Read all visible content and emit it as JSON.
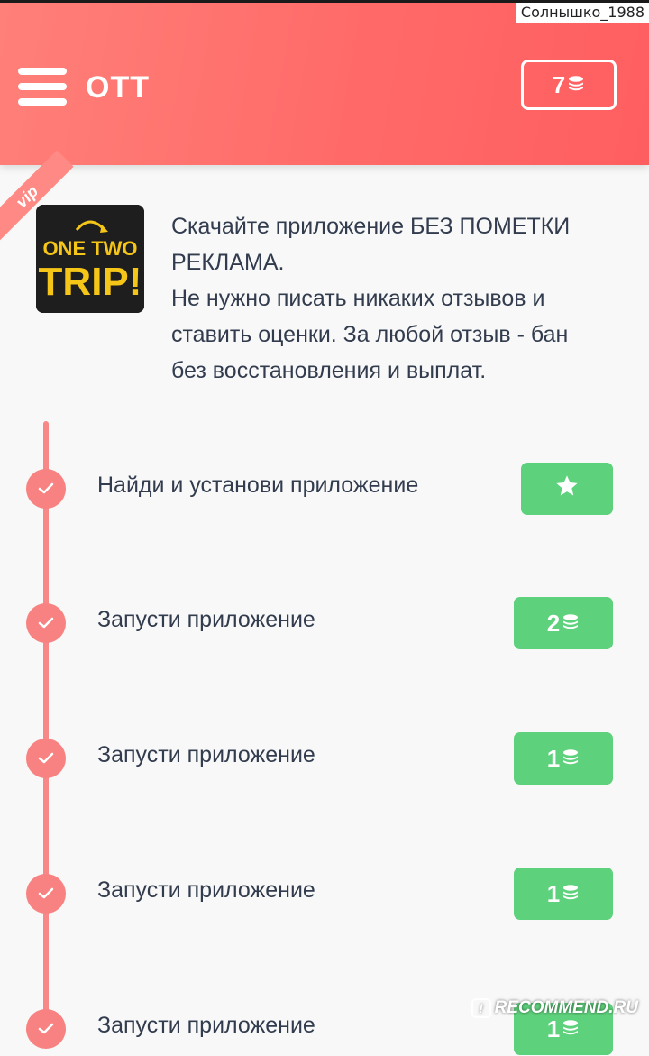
{
  "header": {
    "title": "OTT",
    "balance": "7",
    "menu_icon": "hamburger-menu-icon",
    "coin_icon": "coins-stack-icon",
    "background_color": "#ff6a68"
  },
  "watermarks": {
    "username": "Солнышко_1988",
    "site": "RECOMMEND.RU"
  },
  "offer": {
    "badge": "vip",
    "app_logo": {
      "line1": "ONE TWO",
      "line2": "TRIP!"
    },
    "description_lines": [
      "Скачайте приложение БЕЗ ПОМЕТКИ",
      "РЕКЛАМА.",
      "Не нужно писать никаких отзывов и",
      "ставить оценки. За любой отзыв - бан",
      "без восстановления и выплат."
    ]
  },
  "steps": [
    {
      "label": "Найди и установи приложение",
      "reward_icon": "star-icon",
      "reward": ""
    },
    {
      "label": "Запусти приложение",
      "reward": "2",
      "reward_icon": "coins-stack-icon"
    },
    {
      "label": "Запусти приложение",
      "reward": "1",
      "reward_icon": "coins-stack-icon"
    },
    {
      "label": "Запусти приложение",
      "reward": "1",
      "reward_icon": "coins-stack-icon"
    },
    {
      "label": "Запусти приложение",
      "reward": "1",
      "reward_icon": "coins-stack-icon"
    }
  ],
  "colors": {
    "accent": "#ff6a68",
    "timeline": "#f88888",
    "reward_button": "#5ed17c"
  }
}
